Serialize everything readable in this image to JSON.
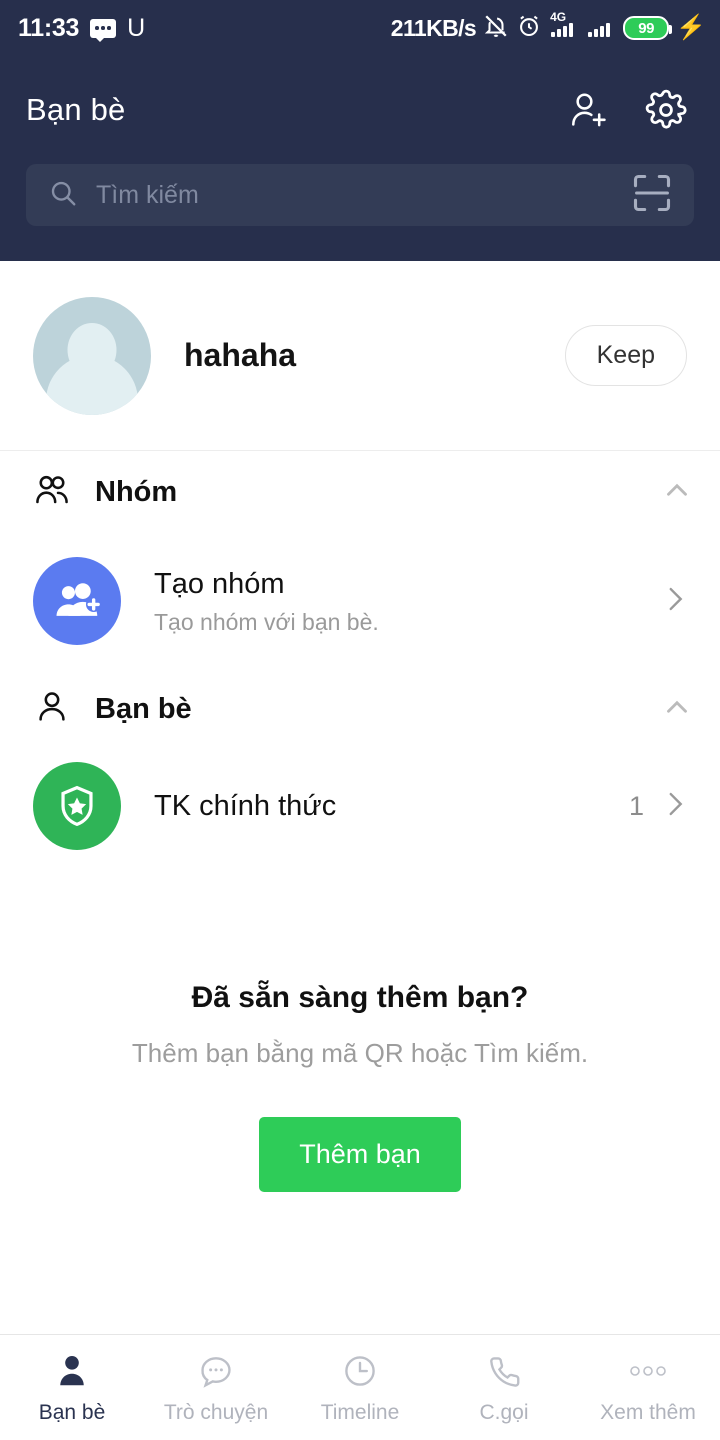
{
  "status_bar": {
    "time": "11:33",
    "sms_icon": "sms-icon",
    "u_icon": "U",
    "network_speed": "211KB/s",
    "mute_icon": "bell-muted-icon",
    "alarm_icon": "alarm-clock-icon",
    "signal_1_icon": "signal-4g-icon",
    "signal_1_label": "4G",
    "signal_2_icon": "signal-bars-icon",
    "battery_level": "99",
    "charging_icon": "⚡"
  },
  "header": {
    "title": "Bạn bè",
    "add_friend_icon": "person-add-icon",
    "settings_icon": "gear-icon"
  },
  "search": {
    "icon": "search-icon",
    "placeholder": "Tìm kiếm",
    "qr_icon": "qr-scan-icon"
  },
  "profile": {
    "avatar_icon": "avatar",
    "name": "hahaha",
    "keep_label": "Keep"
  },
  "sections": [
    {
      "icon": "group-people-icon",
      "title": "Nhóm",
      "collapse_icon": "chevron-up-icon"
    },
    {
      "icon": "person-icon",
      "title": "Bạn bè",
      "collapse_icon": "chevron-up-icon"
    }
  ],
  "create_group": {
    "icon": "group-add-icon",
    "title": "Tạo nhóm",
    "subtitle": "Tạo nhóm với bạn bè.",
    "chevron_icon": "chevron-right-icon"
  },
  "official_account": {
    "icon": "shield-star-icon",
    "title": "TK chính thức",
    "count": "1",
    "chevron_icon": "chevron-right-icon"
  },
  "empty_state": {
    "title": "Đã sẵn sàng thêm bạn?",
    "subtitle": "Thêm bạn bằng mã QR hoặc Tìm kiếm.",
    "button_label": "Thêm bạn"
  },
  "bottom_nav": [
    {
      "label": "Bạn bè",
      "icon": "person-filled-icon",
      "active": true
    },
    {
      "label": "Trò chuyện",
      "icon": "chat-bubble-icon",
      "active": false
    },
    {
      "label": "Timeline",
      "icon": "clock-icon",
      "active": false
    },
    {
      "label": "C.gọi",
      "icon": "phone-icon",
      "active": false
    },
    {
      "label": "Xem thêm",
      "icon": "more-dots-icon",
      "active": false
    }
  ],
  "colors": {
    "header_navy": "#272F4C",
    "search_field": "#333C56",
    "accent_green": "#2ECC58",
    "group_blue": "#5B7BF0",
    "shield_green": "#2FB457",
    "avatar_bg": "#BDD3DA"
  }
}
